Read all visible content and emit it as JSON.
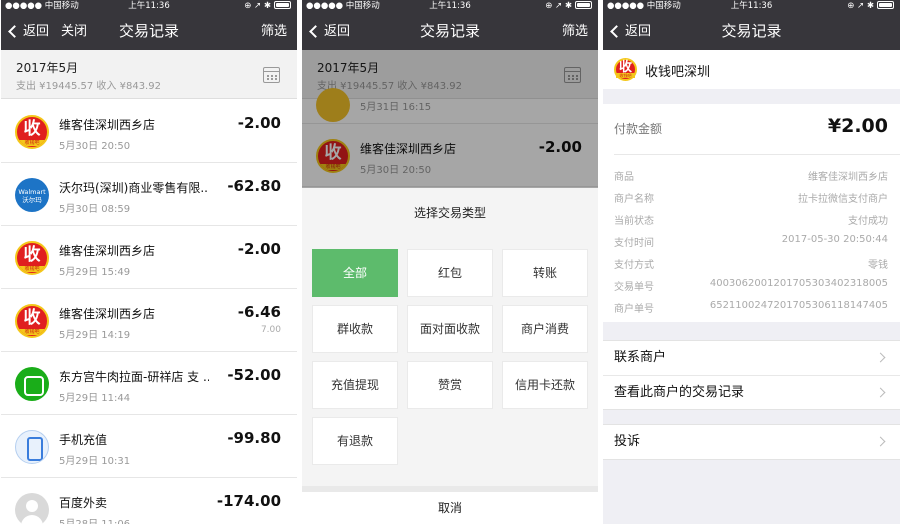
{
  "status": {
    "carrier": "●●●●● 中国移动",
    "time": "上午11:36",
    "icons": "⊕ ↗ ✱"
  },
  "screen1": {
    "nav": {
      "back": "返回",
      "close": "关闭",
      "title": "交易记录",
      "filter": "筛选"
    },
    "month": {
      "title": "2017年5月",
      "summary": "支出 ¥19445.57 收入 ¥843.92"
    },
    "transactions": [
      {
        "icon": "shou-qian-ba-icon",
        "name": "维客佳深圳西乡店",
        "time": "5月30日 20:50",
        "amount": "-2.00",
        "sub": ""
      },
      {
        "icon": "walmart-icon",
        "name": "沃尔玛(深圳)商业零售有限...",
        "time": "5月30日 08:59",
        "amount": "-62.80",
        "sub": ""
      },
      {
        "icon": "shou-qian-ba-icon",
        "name": "维客佳深圳西乡店",
        "time": "5月29日 15:49",
        "amount": "-2.00",
        "sub": ""
      },
      {
        "icon": "shou-qian-ba-icon",
        "name": "维客佳深圳西乡店",
        "time": "5月29日 14:19",
        "amount": "-6.46",
        "sub": "7.00"
      },
      {
        "icon": "green-merchant-icon",
        "name": "东方宫牛肉拉面-研祥店 支 ...",
        "time": "5月29日 11:44",
        "amount": "-52.00",
        "sub": ""
      },
      {
        "icon": "phone-recharge-icon",
        "name": "手机充值",
        "time": "5月29日 10:31",
        "amount": "-99.80",
        "sub": ""
      },
      {
        "icon": "baidu-waimai-icon",
        "name": "百度外卖",
        "time": "5月28日 11:06",
        "amount": "-174.00",
        "sub": ""
      }
    ],
    "walmart_logo_text": "Walmart\n沃尔玛",
    "shou_char": "收",
    "shou_small": "收钱吧"
  },
  "screen2": {
    "nav": {
      "back": "返回",
      "title": "交易记录",
      "filter": "筛选"
    },
    "month": {
      "title": "2017年5月",
      "summary": "支出 ¥19445.57 收入 ¥843.92"
    },
    "peek_time": "5月31日 16:15",
    "peek_tx": {
      "name": "维客佳深圳西乡店",
      "time": "5月30日 20:50",
      "amount": "-2.00"
    },
    "sheet_title": "选择交易类型",
    "options": [
      "全部",
      "红包",
      "转账",
      "群收款",
      "面对面收款",
      "商户消费",
      "充值提现",
      "赞赏",
      "信用卡还款",
      "有退款"
    ],
    "active_option": "全部",
    "cancel": "取消"
  },
  "screen3": {
    "nav": {
      "back": "返回",
      "title": "交易记录"
    },
    "merchant": "收钱吧深圳",
    "pay_label": "付款金额",
    "pay_amount": "¥2.00",
    "details": [
      {
        "k": "商品",
        "v": "维客佳深圳西乡店"
      },
      {
        "k": "商户名称",
        "v": "拉卡拉微信支付商户"
      },
      {
        "k": "当前状态",
        "v": "支付成功"
      },
      {
        "k": "支付时间",
        "v": "2017-05-30 20:50:44"
      },
      {
        "k": "支付方式",
        "v": "零钱"
      },
      {
        "k": "交易单号",
        "v": "4003062001201705303402318005"
      },
      {
        "k": "商户单号",
        "v": "652110024720170530611814​7405"
      }
    ],
    "links": [
      "联系商户",
      "查看此商户的交易记录"
    ],
    "complaint": "投诉"
  }
}
